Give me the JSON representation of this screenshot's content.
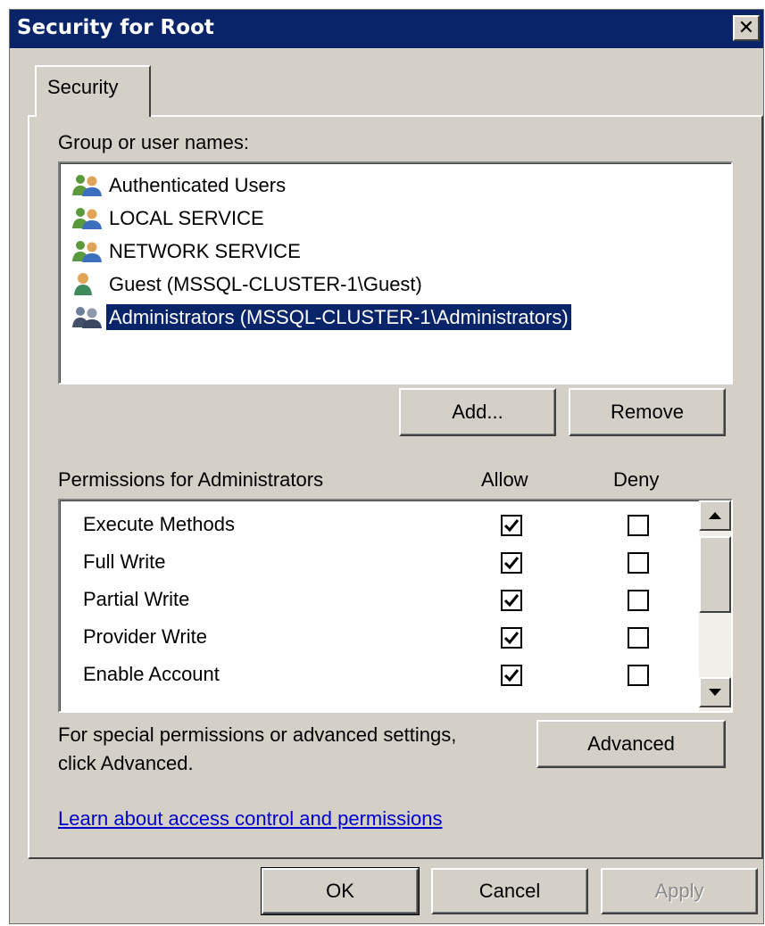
{
  "window": {
    "title": "Security for Root",
    "close_glyph": "✕"
  },
  "tab": {
    "label": "Security"
  },
  "groups": {
    "label": "Group or user names:",
    "items": [
      {
        "name": "Authenticated Users",
        "icon": "group-users-icon",
        "selected": false
      },
      {
        "name": "LOCAL SERVICE",
        "icon": "group-users-icon",
        "selected": false
      },
      {
        "name": "NETWORK SERVICE",
        "icon": "group-users-icon",
        "selected": false
      },
      {
        "name": "Guest (MSSQL-CLUSTER-1\\Guest)",
        "icon": "user-icon",
        "selected": false
      },
      {
        "name": "Administrators (MSSQL-CLUSTER-1\\Administrators)",
        "icon": "admin-group-icon",
        "selected": true
      }
    ],
    "add_label": "Add...",
    "remove_label": "Remove"
  },
  "permissions": {
    "label": "Permissions for Administrators",
    "allow_label": "Allow",
    "deny_label": "Deny",
    "rows": [
      {
        "name": "Execute Methods",
        "allow": true,
        "deny": false
      },
      {
        "name": "Full Write",
        "allow": true,
        "deny": false
      },
      {
        "name": "Partial Write",
        "allow": true,
        "deny": false
      },
      {
        "name": "Provider Write",
        "allow": true,
        "deny": false
      },
      {
        "name": "Enable Account",
        "allow": true,
        "deny": false
      }
    ]
  },
  "advanced": {
    "hint": "For special permissions or advanced settings,",
    "hint2": "click Advanced.",
    "button_label": "Advanced"
  },
  "help_link": "Learn about access control and permissions",
  "footer": {
    "ok_label": "OK",
    "cancel_label": "Cancel",
    "apply_label": "Apply"
  },
  "colors": {
    "titlebar": "#0a246a",
    "selection": "#0a246a",
    "window_bg": "#d4d0c8",
    "link": "#0000cc"
  }
}
